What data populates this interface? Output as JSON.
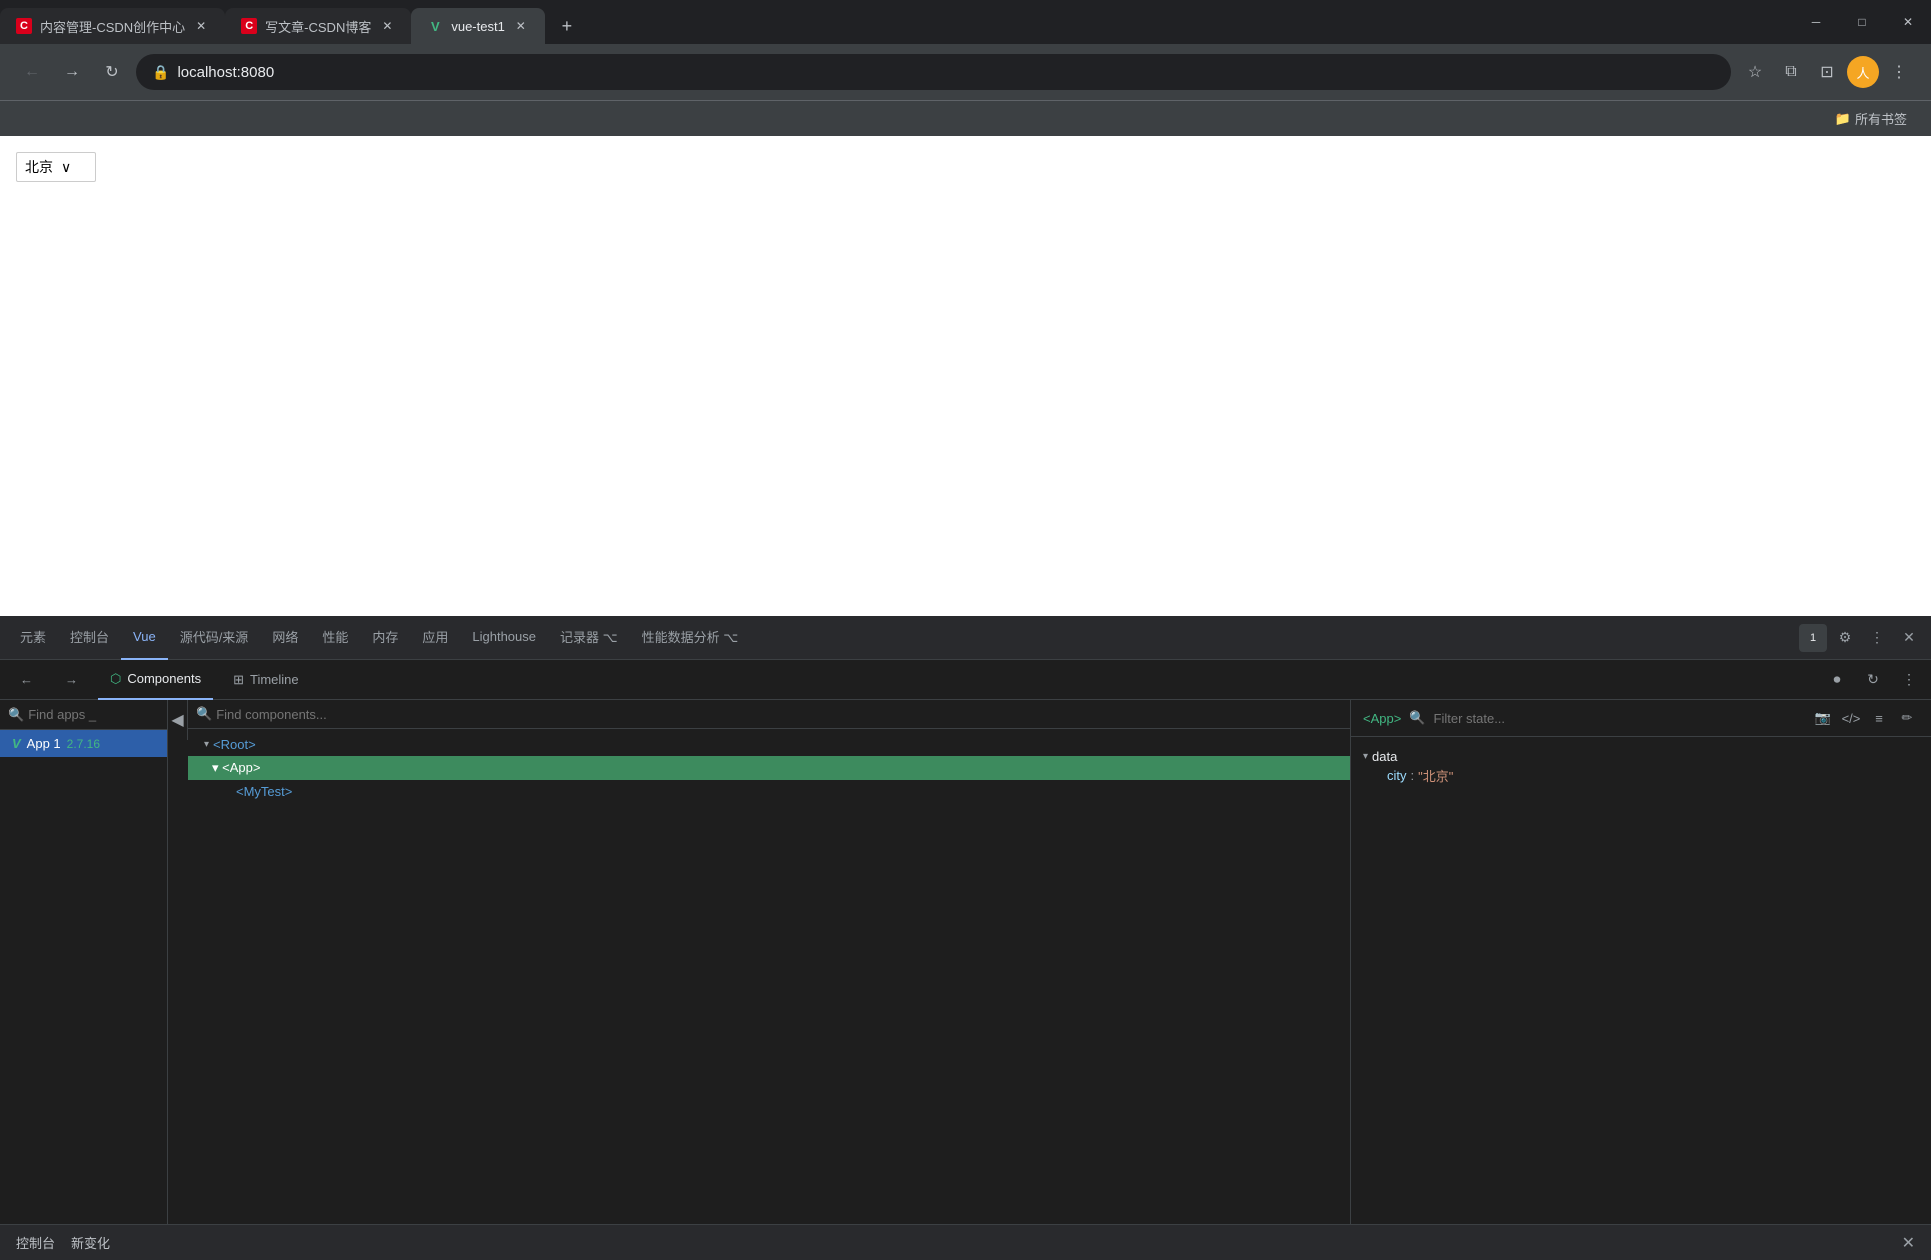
{
  "browser": {
    "tabs": [
      {
        "id": "tab1",
        "favicon_type": "csdn",
        "favicon_text": "C",
        "title": "内容管理-CSDN创作中心",
        "active": false
      },
      {
        "id": "tab2",
        "favicon_type": "csdn",
        "favicon_text": "C",
        "title": "写文章-CSDN博客",
        "active": false
      },
      {
        "id": "tab3",
        "favicon_type": "vue",
        "favicon_text": "V",
        "title": "vue-test1",
        "active": true
      }
    ],
    "url": "localhost:8080",
    "bookmarks_label": "所有书签"
  },
  "page": {
    "select_value": "北京",
    "select_arrow": "∨"
  },
  "devtools": {
    "tabs": [
      {
        "id": "elements",
        "label": "元素"
      },
      {
        "id": "console",
        "label": "控制台"
      },
      {
        "id": "vue",
        "label": "Vue",
        "active": true
      },
      {
        "id": "sources",
        "label": "源代码/来源"
      },
      {
        "id": "network",
        "label": "网络"
      },
      {
        "id": "performance",
        "label": "性能"
      },
      {
        "id": "memory",
        "label": "内存"
      },
      {
        "id": "application",
        "label": "应用"
      },
      {
        "id": "lighthouse",
        "label": "Lighthouse"
      },
      {
        "id": "recorder",
        "label": "记录器 ⌥"
      },
      {
        "id": "perf_insights",
        "label": "性能数据分析 ⌥"
      }
    ],
    "tab_badge": "1",
    "subtabs": [
      {
        "id": "components",
        "label": "Components",
        "active": true,
        "icon": "⬡"
      },
      {
        "id": "timeline",
        "label": "Timeline",
        "active": false,
        "icon": "⊞"
      }
    ],
    "app_sidebar": {
      "search_placeholder": "Find apps _",
      "apps": [
        {
          "id": "app1",
          "label": "App 1",
          "version": "2.7.16",
          "selected": true
        }
      ]
    },
    "component_tree": {
      "search_placeholder": "Find components...",
      "nodes": [
        {
          "id": "root",
          "label": "<Root>",
          "expanded": true,
          "indent": 0,
          "selected": false
        },
        {
          "id": "app",
          "label": "<App>",
          "expanded": true,
          "indent": 1,
          "selected": true
        },
        {
          "id": "mytest",
          "label": "<MyTest>",
          "expanded": false,
          "indent": 2,
          "selected": false
        }
      ]
    },
    "state_panel": {
      "component_tag": "<App>",
      "filter_placeholder": "Filter state...",
      "data": {
        "section": "data",
        "properties": [
          {
            "key": "city",
            "value": "\"北京\""
          }
        ]
      }
    }
  },
  "status_bar": {
    "console_label": "控制台",
    "changes_label": "新变化"
  },
  "icons": {
    "back": "←",
    "forward": "→",
    "refresh": "↻",
    "lock": "🔒",
    "star": "☆",
    "extensions": "⧉",
    "profile": "👤",
    "menu": "⋮",
    "minimize": "─",
    "restore": "□",
    "close": "✕",
    "collapse": "◀",
    "search": "🔍",
    "arrow_down": "▾",
    "arrow_right": "▶",
    "refresh_small": "↻",
    "camera": "📷",
    "code": "</>",
    "list": "≡",
    "edit": "✏",
    "dots": "⋮",
    "record": "⏺",
    "reload": "↻",
    "components_icon": "⬡",
    "timeline_icon": "⊞"
  }
}
